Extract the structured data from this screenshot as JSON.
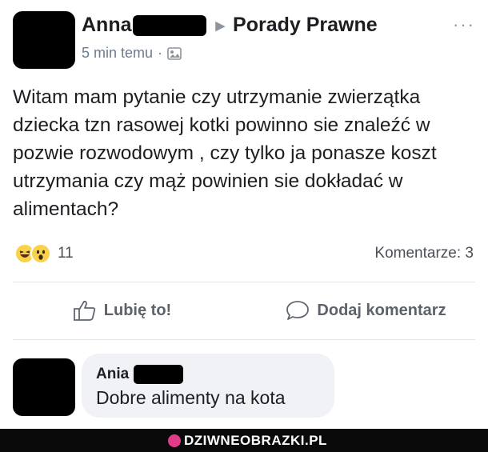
{
  "post": {
    "author_name": "Anna",
    "group_name": "Porady Prawne",
    "timestamp": "5 min temu",
    "separator": "·",
    "more_label": "···",
    "text": "Witam mam pytanie czy utrzymanie zwierzątka dziecka tzn rasowej kotki powinno sie znaleźć w pozwie rozwodowym , czy tylko ja ponasze koszt utrzymania czy mąż powinien sie dokładać w alimentach?",
    "reaction_count": "11",
    "comments_label": "Komentarze: 3",
    "reactions": [
      "haha-icon",
      "wow-icon"
    ]
  },
  "actions": {
    "like_label": "Lubię to!",
    "comment_label": "Dodaj komentarz"
  },
  "comment": {
    "author_name": "Ania",
    "text": "Dobre alimenty na kota"
  },
  "footer": {
    "watermark": "DZIWNEOBRAZKI.PL"
  },
  "colors": {
    "text": "#1c1e21",
    "meta": "#6d7b8f",
    "bubble": "#f0f2f5",
    "reaction_yellow": "#f7d24a"
  }
}
